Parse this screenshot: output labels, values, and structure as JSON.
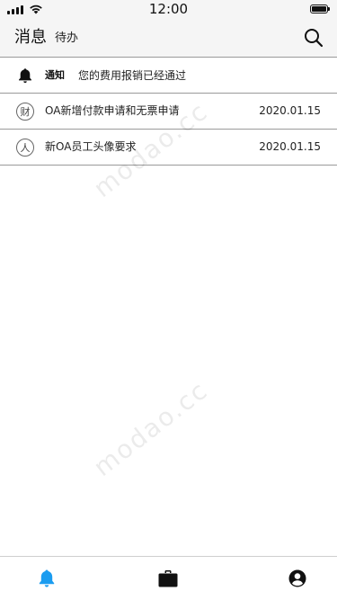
{
  "status_bar": {
    "time": "12:00"
  },
  "header": {
    "tab_messages": "消息",
    "tab_todo": "待办"
  },
  "notice": {
    "label": "通知",
    "text": "您的费用报销已经通过"
  },
  "messages": [
    {
      "icon_char": "财",
      "title": "OA新增付款申请和无票申请",
      "date": "2020.01.15"
    },
    {
      "icon_char": "人",
      "title": "新OA员工头像要求",
      "date": "2020.01.15"
    }
  ],
  "watermark": {
    "text": "modao.cc"
  },
  "tabbar": {
    "items": [
      "bell-icon",
      "briefcase-icon",
      "profile-icon"
    ],
    "active_color": "#1a9cf0",
    "inactive_color": "#111111"
  }
}
